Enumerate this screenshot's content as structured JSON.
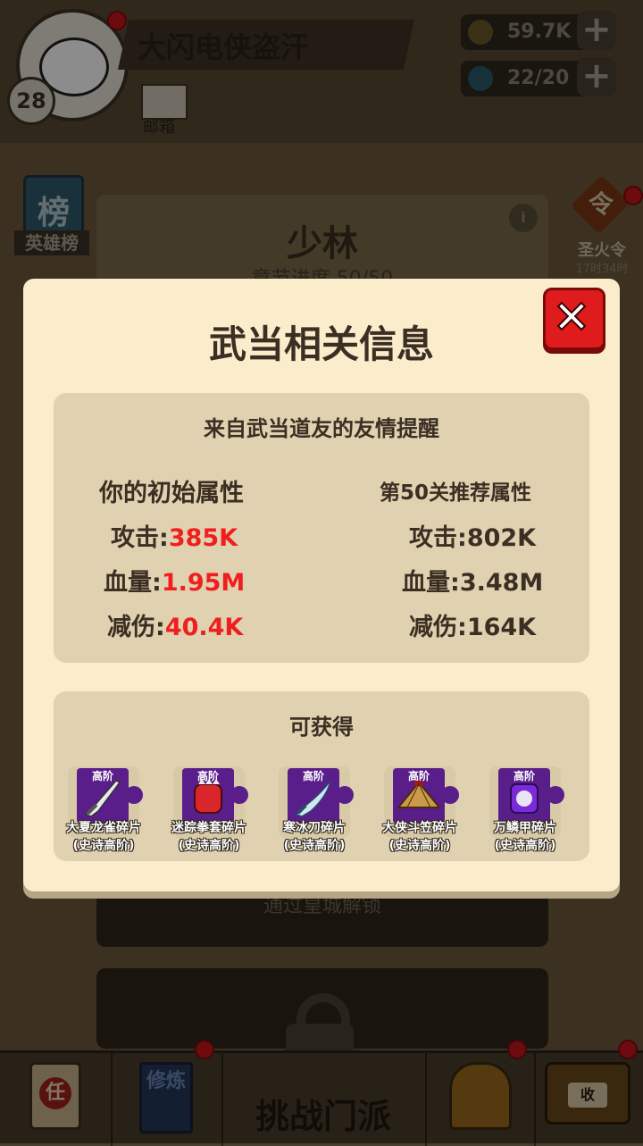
{
  "player": {
    "name": "大闪电侠盗汗",
    "level": "28",
    "mail_label": "邮箱"
  },
  "resources": [
    {
      "icon": "coin-icon",
      "value": "59.7K"
    },
    {
      "icon": "gem-icon",
      "value": "22/20"
    }
  ],
  "background": {
    "rank_label": "英雄榜",
    "rank_glyph": "榜",
    "sect_title": "少林",
    "sect_progress": "章节进度 50/50",
    "flame_glyph": "令",
    "flame_label": "圣火令",
    "flame_timer": "17时34时",
    "unlock_text": "通过皇城解锁"
  },
  "bottom_nav": {
    "task_glyph": "任",
    "train_glyph": "修炼",
    "challenge_label": "挑战门派",
    "chest_glyph": "收"
  },
  "modal": {
    "title": "武当相关信息",
    "tip_header": "来自武当道友的友情提醒",
    "left_header": "你的初始属性",
    "right_header": "第50关推荐属性",
    "stats_left": [
      {
        "label": "攻击:",
        "value": "385K"
      },
      {
        "label": "血量:",
        "value": "1.95M"
      },
      {
        "label": "减伤:",
        "value": "40.4K"
      }
    ],
    "stats_right": [
      {
        "label": "攻击:",
        "value": "802K"
      },
      {
        "label": "血量:",
        "value": "3.48M"
      },
      {
        "label": "减伤:",
        "value": "164K"
      }
    ],
    "rewards_header": "可获得",
    "rewards": [
      {
        "grade": "高阶",
        "name": "大夏龙雀碎片",
        "rarity": "(史诗高阶)",
        "icon": "sword-icon"
      },
      {
        "grade": "高阶",
        "name": "迷踪拳套碎片",
        "rarity": "(史诗高阶)",
        "icon": "glove-icon"
      },
      {
        "grade": "高阶",
        "name": "寒冰刀碎片",
        "rarity": "(史诗高阶)",
        "icon": "blade-icon"
      },
      {
        "grade": "高阶",
        "name": "大侠斗笠碎片",
        "rarity": "(史诗高阶)",
        "icon": "hat-icon"
      },
      {
        "grade": "高阶",
        "name": "万鳞甲碎片",
        "rarity": "(史诗高阶)",
        "icon": "armor-icon"
      }
    ]
  },
  "colors": {
    "highlight": "#f01e1e",
    "modal_bg": "#fbeccb",
    "panel_bg": "#e0d2b0",
    "close_bg": "#e01b1b"
  }
}
